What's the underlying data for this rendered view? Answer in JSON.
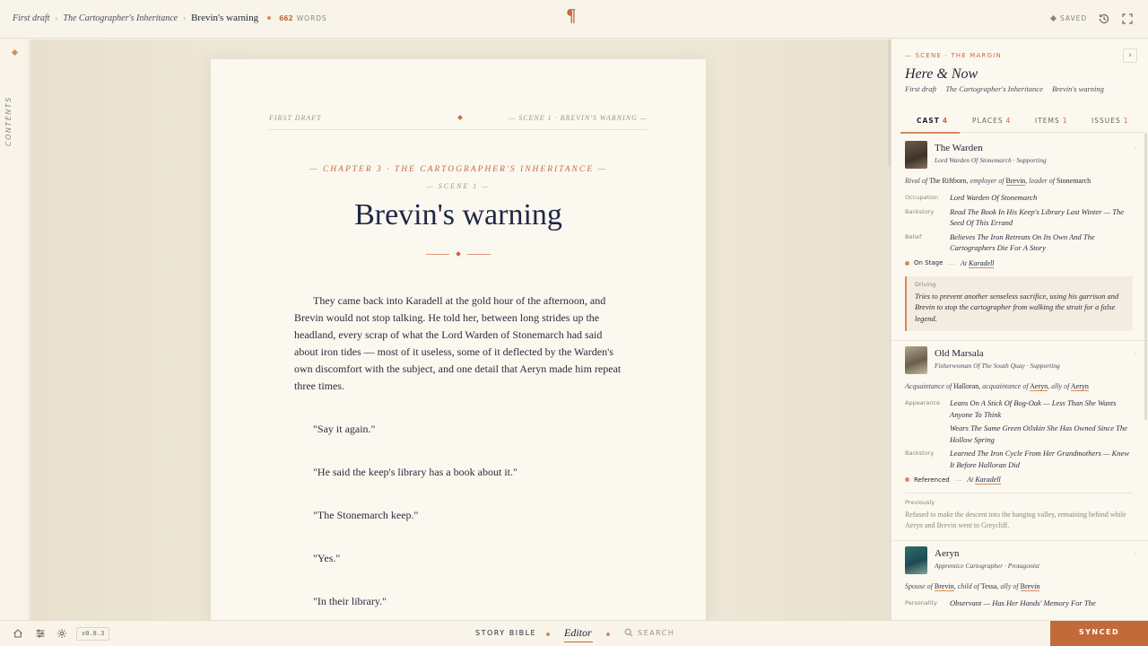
{
  "topbar": {
    "crumbs": [
      "First draft",
      "The Cartographer's Inheritance"
    ],
    "current": "Brevin's warning",
    "word_count": "662",
    "word_label": "WORDS",
    "logo_glyph": "¶",
    "saved_label": "SAVED"
  },
  "rail": {
    "label": "CONTENTS"
  },
  "page": {
    "running_left": "FIRST DRAFT",
    "running_right": "— SCENE 1 · BREVIN'S WARNING —",
    "chapter": "— CHAPTER 3 · THE CARTOGRAPHER'S INHERITANCE —",
    "scene": "— SCENE 1 —",
    "title": "Brevin's warning",
    "paragraph": "They came back into Karadell at the gold hour of the afternoon, and Brevin would not stop talking. He told her, between long strides up the headland, every scrap of what the Lord Warden of Stonemarch had said about iron tides — most of it useless, some of it deflected by the Warden's own discomfort with the subject, and one detail that Aeryn made him repeat three times.",
    "dialogue": [
      "\"Say it again.\"",
      "\"He said the keep's library has a book about it.\"",
      "\"The Stonemarch keep.\"",
      "\"Yes.\"",
      "\"In their library.\""
    ]
  },
  "panel": {
    "section": "— SCENE · THE MARGIN",
    "close_glyph": "›",
    "title": "Here & Now",
    "crumbs": [
      "First draft",
      "The Cartographer's Inheritance",
      "Brevin's warning"
    ],
    "tabs": [
      {
        "label": "CAST",
        "count": "4"
      },
      {
        "label": "PLACES",
        "count": "4"
      },
      {
        "label": "ITEMS",
        "count": "1"
      },
      {
        "label": "ISSUES",
        "count": "1"
      }
    ],
    "cards": [
      {
        "name": "The Warden",
        "role": "Lord Warden Of Stonemarch · Supporting",
        "rel": {
          "t1": "Rival of",
          "n1": "The Riftborn",
          "t2": ", employer of",
          "n2": "Brevin",
          "t3": ", leader of",
          "n3": "Stonemarch"
        },
        "attrs": [
          {
            "k": "Occupation",
            "v": "Lord Warden Of Stonemarch"
          },
          {
            "k": "Backstory",
            "v": "Read The Book In His Keep's Library Last Winter — The Seed Of This Errand"
          },
          {
            "k": "Belief",
            "v": "Believes The Iron Retreats On Its Own And The Cartographers Die For A Story"
          }
        ],
        "status": "On Stage",
        "at": "At",
        "place": "Karadell",
        "driving_label": "Driving",
        "driving": "Tries to prevent another senseless sacrifice, using his garrison and Brevin to stop the cartographer from walking the strait for a false legend."
      },
      {
        "name": "Old Marsala",
        "role": "Fisherwoman Of The South Quay · Supporting",
        "rel": {
          "t1": "Acquaintance of",
          "n1": "Halloran",
          "t2": ", acquaintance of",
          "n2": "Aeryn",
          "t3": ", ally of",
          "n3": "Aeryn"
        },
        "attrs": [
          {
            "k": "Appearance",
            "v": "Leans On A Stick Of Bog-Oak — Less Than She Wants Anyone To Think"
          },
          {
            "k": "",
            "v": "Wears The Same Green Oilskin She Has Owned Since The Hollow Spring"
          },
          {
            "k": "Backstory",
            "v": "Learned The Iron Cycle From Her Grandmothers — Knew It Before Halloran Did"
          }
        ],
        "status": "Referenced",
        "at": "At",
        "place": "Karadell",
        "prev_label": "Previously",
        "prev": "Refused to make the descent into the hanging valley, remaining behind while Aeryn and Brevin went to Greycliff."
      },
      {
        "name": "Aeryn",
        "role": "Apprentice Cartographer · Protagonist",
        "rel": {
          "t1": "Spouse of",
          "n1": "Brevin",
          "t2": ", child of",
          "n2": "Tessa",
          "t3": ", ally of",
          "n3": "Brevin"
        },
        "attrs": [
          {
            "k": "Personality",
            "v": "Observant — Has Her Hands' Memory For The"
          }
        ]
      }
    ]
  },
  "bottombar": {
    "version": "v0.8.3",
    "story_bible": "STORY BIBLE",
    "editor": "Editor",
    "search": "SEARCH",
    "synced": "SYNCED"
  },
  "colors": {
    "accent": "#c76a3b",
    "ink": "#1f2747",
    "paper": "#fbf8f0"
  }
}
